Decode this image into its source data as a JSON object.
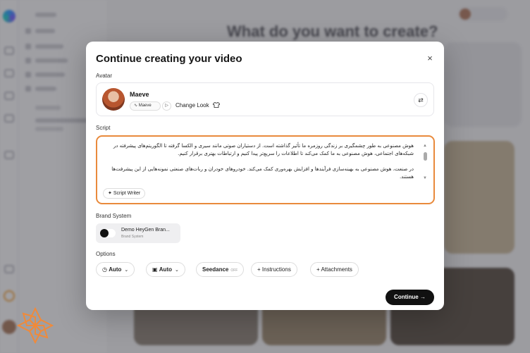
{
  "background": {
    "heading": "What do you want to create?"
  },
  "modal": {
    "title": "Continue creating your video",
    "close_icon": "×",
    "avatar": {
      "label": "Avatar",
      "name": "Maeve",
      "voice": "Maeve",
      "change_look": "Change Look",
      "swap_icon": "⇄"
    },
    "script": {
      "label": "Script",
      "paragraphs": [
        "هوش مصنوعی به طور چشمگیری بر زندگی روزمره ما تأثیر گذاشته است. از دستیاران صوتی مانند سیری و الکسا گرفته تا الگوریتم‌های پیشرفته در شبکه‌های اجتماعی، هوش مصنوعی به ما کمک می‌کند تا اطلاعات را سریع‌تر پیدا کنیم و ارتباطات بهتری برقرار کنیم.",
        "در صنعت، هوش مصنوعی به بهینه‌سازی فرآیندها و افزایش بهره‌وری کمک می‌کند. خودروهای خودران و ربات‌های صنعتی نمونه‌هایی از این پیشرفت‌ها هستند."
      ],
      "writer_label": "Script Writer"
    },
    "brand": {
      "label": "Brand System",
      "name": "Demo HeyGen Bran...",
      "sub": "Brand System"
    },
    "options": {
      "label": "Options",
      "auto1": "Auto",
      "auto2": "Auto",
      "seedance": "Seedance",
      "seedance_state": "OFF",
      "instructions": "Instructions",
      "attachments": "Attachments"
    },
    "continue": "Continue"
  },
  "colors": {
    "accent_border": "#e98a3c",
    "primary_button": "#111111"
  }
}
